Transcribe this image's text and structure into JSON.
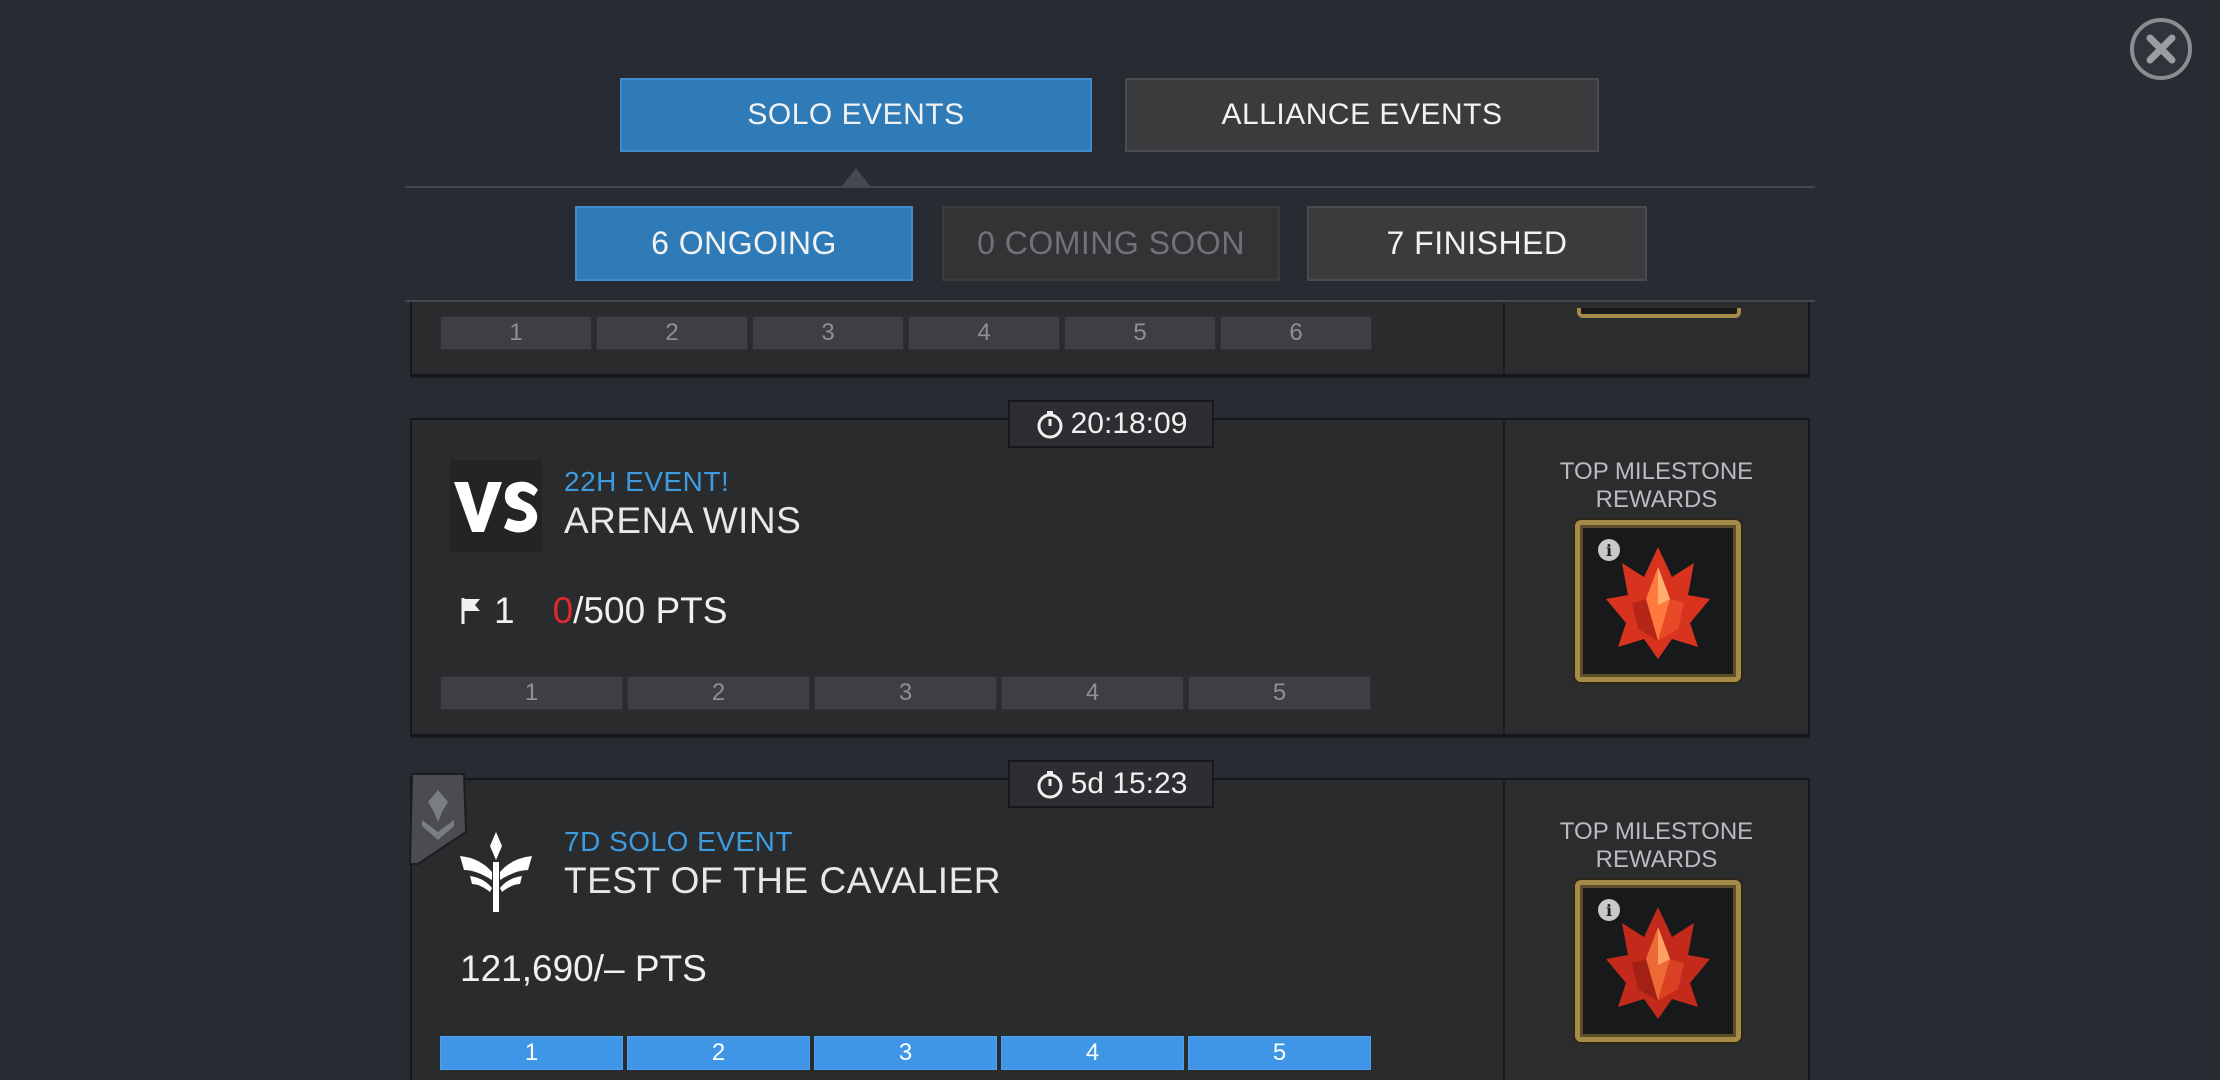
{
  "tabs": {
    "solo_label": "SOLO EVENTS",
    "alliance_label": "ALLIANCE EVENTS"
  },
  "subtabs": {
    "ongoing_label": "6 ONGOING",
    "coming_soon_label": "0 COMING SOON",
    "finished_label": "7 FINISHED"
  },
  "partial_card": {
    "milestones": [
      "1",
      "2",
      "3",
      "4",
      "5",
      "6"
    ]
  },
  "events": [
    {
      "timer": "20:18:09",
      "subtitle": "22H EVENT!",
      "title": "ARENA WINS",
      "flag_rank": "1",
      "points_current": "0",
      "points_target": "/500 PTS",
      "milestones": [
        "1",
        "2",
        "3",
        "4",
        "5"
      ],
      "reward_title": "TOP MILESTONE REWARDS",
      "icon": "vs-icon"
    },
    {
      "timer": "5d 15:23",
      "subtitle": "7D SOLO EVENT",
      "title": "TEST OF THE CAVALIER",
      "points_text": "121,690/– PTS",
      "milestones": [
        "1",
        "2",
        "3",
        "4",
        "5"
      ],
      "reward_title": "TOP MILESTONE REWARDS",
      "icon": "cavalier-icon"
    }
  ],
  "colors": {
    "accent_blue": "#2e7bb8",
    "subtitle_blue": "#3d9be0",
    "milestone_done": "#3f95e6",
    "points_red": "#e0282e",
    "reward_gold": "#a58b4a"
  }
}
